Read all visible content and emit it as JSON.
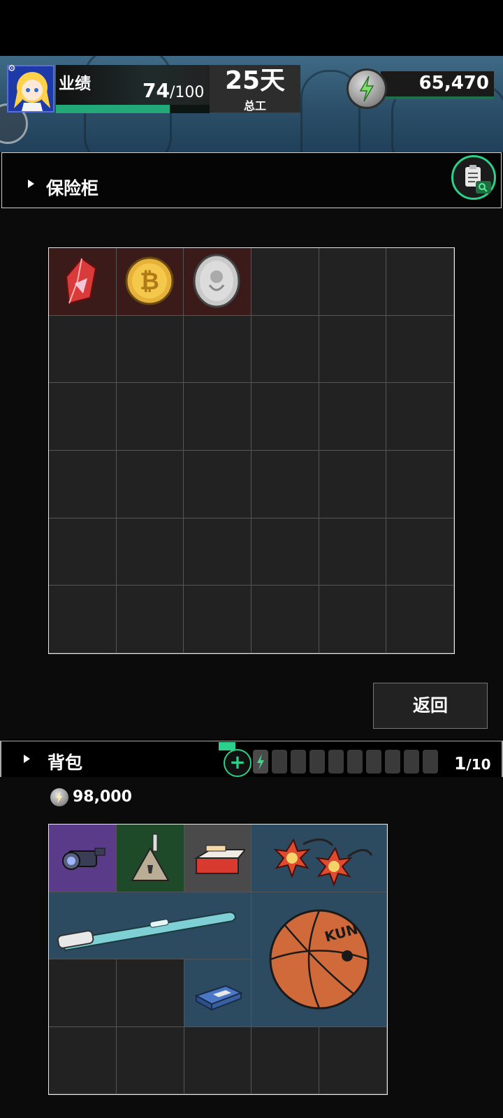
{
  "header": {
    "performance_label": "业绩",
    "performance_current": "74",
    "performance_max": "/100",
    "performance_fraction": 0.74,
    "days_value": "25天",
    "days_label": "总工",
    "energy_value": "65,470"
  },
  "safe": {
    "title": "保险柜",
    "grid_cols": 6,
    "grid_rows": 6,
    "items": [
      {
        "name": "red-crystal-item",
        "icon": "red-gem-icon"
      },
      {
        "name": "bitcoin-coin-item",
        "icon": "gold-bitcoin-icon"
      },
      {
        "name": "silver-coin-item",
        "icon": "silver-bird-coin-icon"
      }
    ]
  },
  "return_button": "返回",
  "backpack": {
    "title": "背包",
    "count_current": "1",
    "count_max": "/10",
    "money": "98,000",
    "grid_cols": 5,
    "grid_rows": 4,
    "items": [
      {
        "name": "camera-scope-item",
        "icon": "scope-icon"
      },
      {
        "name": "triangle-warning-item",
        "icon": "warning-triangle-icon"
      },
      {
        "name": "cigarette-pack-item",
        "icon": "cigarette-pack-icon"
      },
      {
        "name": "spiked-mace-item",
        "icon": "spiked-ball-icon"
      },
      {
        "name": "electric-toothbrush-item",
        "icon": "toothbrush-icon"
      },
      {
        "name": "basketball-item",
        "icon": "basketball-icon"
      },
      {
        "name": "battery-card-item",
        "icon": "battery-card-icon"
      }
    ]
  }
}
